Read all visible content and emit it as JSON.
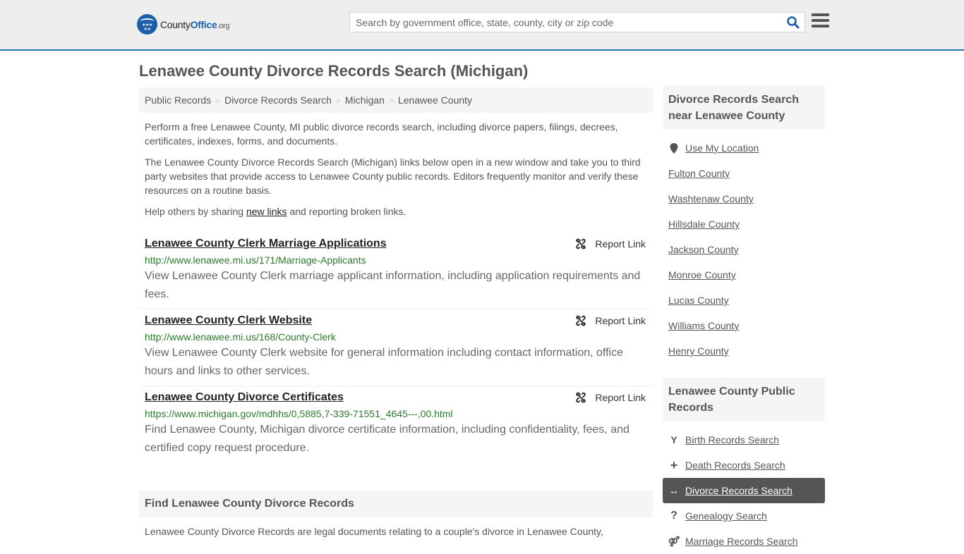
{
  "header": {
    "logo": {
      "county": "County",
      "office": "Office",
      "org": ".org"
    },
    "search": {
      "placeholder": "Search by government office, state, county, city or zip code",
      "value": ""
    },
    "search_icon": "search-icon",
    "menu_icon": "hamburger-icon"
  },
  "page": {
    "title": "Lenawee County Divorce Records Search (Michigan)"
  },
  "breadcrumb": [
    {
      "label": "Public Records"
    },
    {
      "label": "Divorce Records Search"
    },
    {
      "label": "Michigan"
    },
    {
      "label": "Lenawee County"
    }
  ],
  "breadcrumb_sep": ">",
  "intro": {
    "p1": "Perform a free Lenawee County, MI public divorce records search, including divorce papers, filings, decrees, certificates, indexes, forms, and documents.",
    "p2": "The Lenawee County Divorce Records Search (Michigan) links below open in a new window and take you to third party websites that provide access to Lenawee County public records. Editors frequently monitor and verify these resources on a routine basis.",
    "p3_before": "Help others by sharing ",
    "p3_link": "new links",
    "p3_after": " and reporting broken links."
  },
  "results": [
    {
      "title": "Lenawee County Clerk Marriage Applications",
      "url": "http://www.lenawee.mi.us/171/Marriage-Applicants",
      "description": "View Lenawee County Clerk marriage applicant information, including application requirements and fees.",
      "report_label": "Report Link"
    },
    {
      "title": "Lenawee County Clerk Website",
      "url": "http://www.lenawee.mi.us/168/County-Clerk",
      "description": "View Lenawee County Clerk website for general information including contact information, office hours and links to other services.",
      "report_label": "Report Link"
    },
    {
      "title": "Lenawee County Divorce Certificates",
      "url": "https://www.michigan.gov/mdhhs/0,5885,7-339-71551_4645---,00.html",
      "description": "Find Lenawee County, Michigan divorce certificate information, including confidentiality, fees, and certified copy request procedure.",
      "report_label": "Report Link"
    }
  ],
  "find_section": {
    "heading": "Find Lenawee County Divorce Records",
    "text": "Lenawee County Divorce Records are legal documents relating to a couple's divorce in Lenawee County,"
  },
  "sidebar": {
    "nearby": {
      "heading": "Divorce Records Search near Lenawee County",
      "use_location": "Use My Location",
      "items": [
        "Fulton County",
        "Washtenaw County",
        "Hillsdale County",
        "Jackson County",
        "Monroe County",
        "Lucas County",
        "Williams County",
        "Henry County"
      ]
    },
    "public_records": {
      "heading": "Lenawee County Public Records",
      "items": [
        {
          "label": "Birth Records Search",
          "icon": "child-icon",
          "glyph": "Y",
          "active": false
        },
        {
          "label": "Death Records Search",
          "icon": "plus-icon",
          "glyph": "+",
          "active": false
        },
        {
          "label": "Divorce Records Search",
          "icon": "arrows-horizontal-icon",
          "glyph": "↔",
          "active": true
        },
        {
          "label": "Genealogy Search",
          "icon": "question-icon",
          "glyph": "?",
          "active": false
        },
        {
          "label": "Marriage Records Search",
          "icon": "gender-icon",
          "glyph": "⚤",
          "active": false
        }
      ]
    }
  }
}
